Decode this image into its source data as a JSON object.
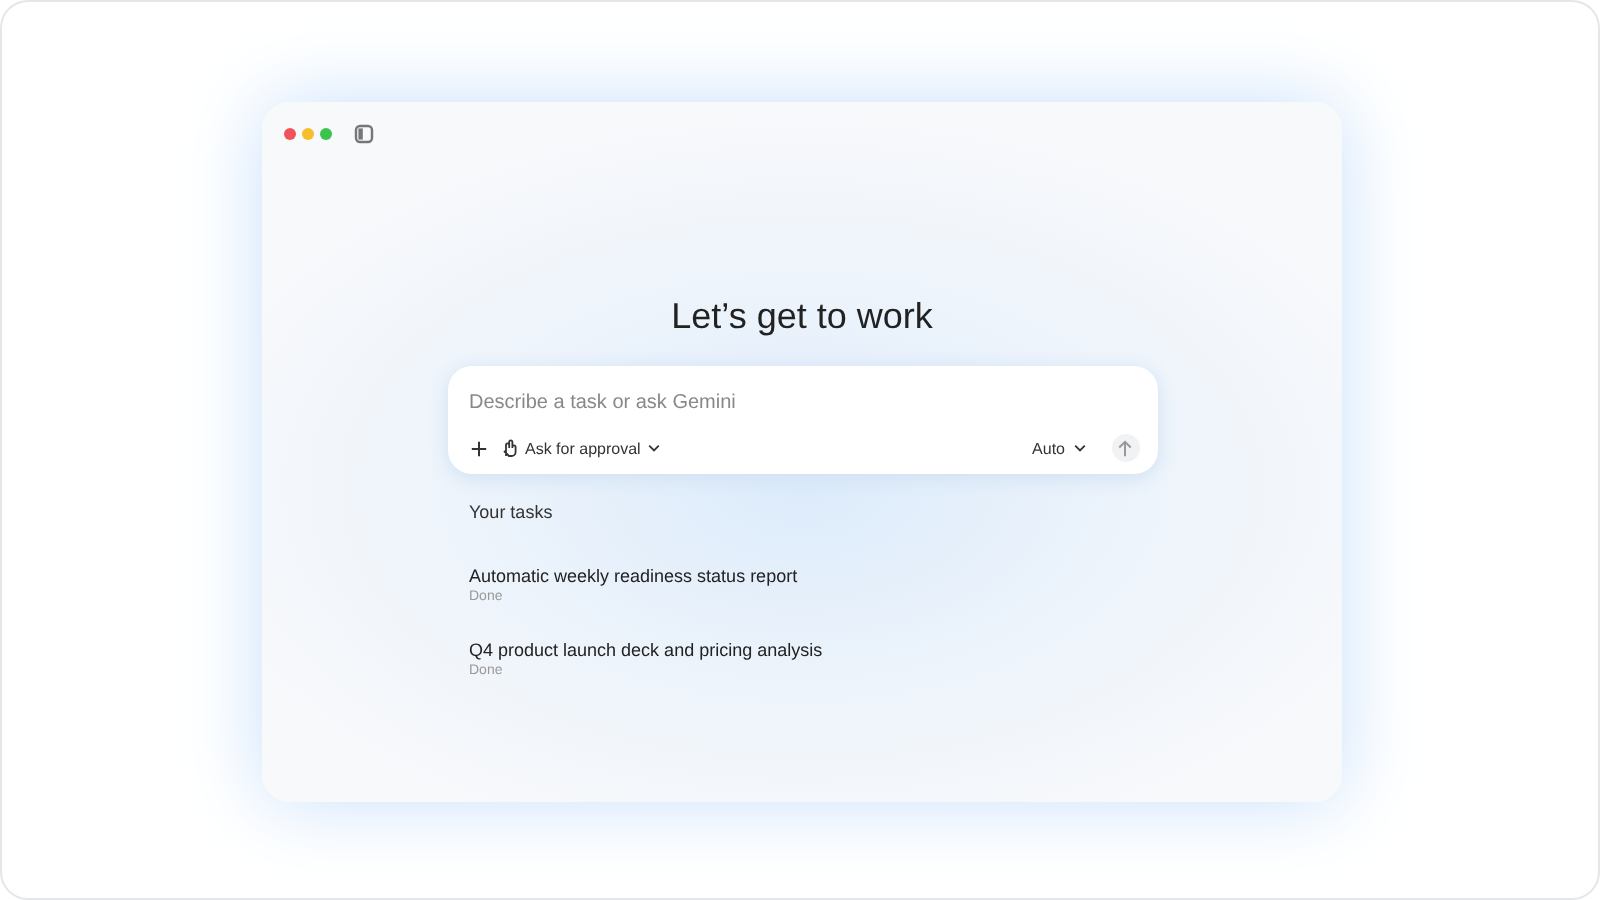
{
  "heading": "Let’s get to work",
  "composer": {
    "placeholder": "Describe a task or ask Gemini",
    "approval": "Ask for approval",
    "model": "Auto"
  },
  "tasks": {
    "title": "Your tasks",
    "items": [
      {
        "name": "Automatic weekly readiness status report",
        "status": "Done"
      },
      {
        "name": "Q4 product launch deck and pricing analysis",
        "status": "Done"
      }
    ]
  }
}
